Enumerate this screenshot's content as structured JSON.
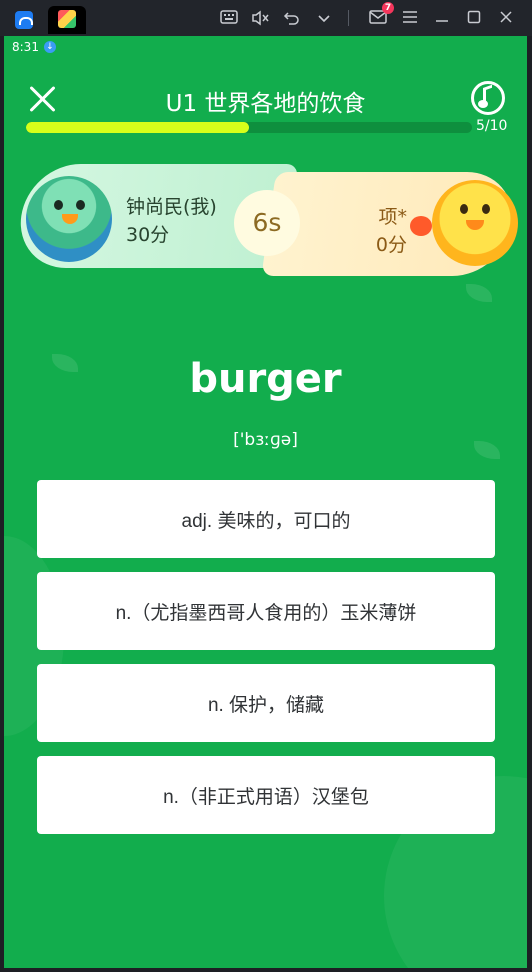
{
  "emulator": {
    "icons": [
      "home-app-icon",
      "game-tab-icon",
      "keyboard-icon",
      "mute-icon",
      "undo-icon",
      "chevron-down-icon",
      "mail-icon",
      "menu-icon",
      "minimize-icon",
      "maximize-icon",
      "close-icon"
    ],
    "mail_badge": "7"
  },
  "status_bar": {
    "time": "8:31"
  },
  "header": {
    "title": "U1 世界各地的饮食",
    "progress_text": "5/10",
    "progress_fraction": 0.5
  },
  "battle": {
    "player": {
      "name": "钟尚民(我)",
      "score": "30分"
    },
    "opponent": {
      "name": "项*",
      "score": "0分"
    },
    "timer": "6s"
  },
  "question": {
    "word": "burger",
    "phonetic": "['bɜːɡə]"
  },
  "options": [
    {
      "label": "adj. 美味的，可口的"
    },
    {
      "label": "n.（尤指墨西哥人食用的）玉米薄饼"
    },
    {
      "label": "n. 保护，储藏"
    },
    {
      "label": "n.（非正式用语）汉堡包"
    }
  ],
  "colors": {
    "background": "#12ad4d",
    "progress_fill": "#d7ff1a",
    "player_card": "#c9f3d9",
    "opponent_card": "#ffeec4"
  }
}
